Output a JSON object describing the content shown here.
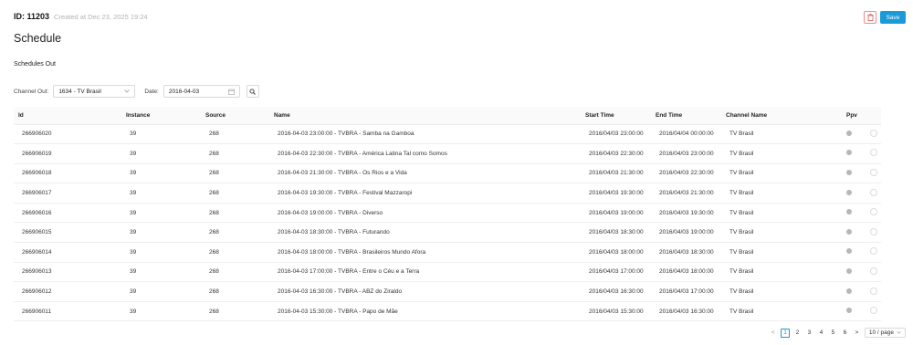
{
  "header": {
    "id_label": "ID: 11203",
    "created_text": "Created at Dec 23, 2025 19:24",
    "save_label": "Save"
  },
  "page_title": "Schedule",
  "section_title": "Schedules Out",
  "filters": {
    "channel_label": "Channel Out:",
    "channel_value": "1634 - TV Brasil",
    "date_label": "Date:",
    "date_value": "2016-04-03"
  },
  "table": {
    "columns": [
      "Id",
      "Instance",
      "Source",
      "Name",
      "Start Time",
      "End Time",
      "Channel Name",
      "Ppv"
    ],
    "rows": [
      {
        "id": "266906020",
        "instance": "39",
        "source": "268",
        "name": "2016-04-03 23:00:00 - TVBRA - Samba na Gamboa",
        "start": "2016/04/03 23:00:00",
        "end": "2016/04/04 00:00:00",
        "channel": "TV Brasil"
      },
      {
        "id": "266906019",
        "instance": "39",
        "source": "268",
        "name": "2016-04-03 22:30:00 - TVBRA - América Latina Tal como Somos",
        "start": "2016/04/03 22:30:00",
        "end": "2016/04/03 23:00:00",
        "channel": "TV Brasil"
      },
      {
        "id": "266906018",
        "instance": "39",
        "source": "268",
        "name": "2016-04-03 21:30:00 - TVBRA - Os Rios e a Vida",
        "start": "2016/04/03 21:30:00",
        "end": "2016/04/03 22:30:00",
        "channel": "TV Brasil"
      },
      {
        "id": "266906017",
        "instance": "39",
        "source": "268",
        "name": "2016-04-03 19:30:00 - TVBRA - Festival Mazzaropi",
        "start": "2016/04/03 19:30:00",
        "end": "2016/04/03 21:30:00",
        "channel": "TV Brasil"
      },
      {
        "id": "266906016",
        "instance": "39",
        "source": "268",
        "name": "2016-04-03 19:00:00 - TVBRA - Diverso",
        "start": "2016/04/03 19:00:00",
        "end": "2016/04/03 19:30:00",
        "channel": "TV Brasil"
      },
      {
        "id": "266906015",
        "instance": "39",
        "source": "268",
        "name": "2016-04-03 18:30:00 - TVBRA - Futurando",
        "start": "2016/04/03 18:30:00",
        "end": "2016/04/03 19:00:00",
        "channel": "TV Brasil"
      },
      {
        "id": "266906014",
        "instance": "39",
        "source": "268",
        "name": "2016-04-03 18:00:00 - TVBRA - Brasileiros Mundo Afora",
        "start": "2016/04/03 18:00:00",
        "end": "2016/04/03 18:30:00",
        "channel": "TV Brasil"
      },
      {
        "id": "266906013",
        "instance": "39",
        "source": "268",
        "name": "2016-04-03 17:00:00 - TVBRA - Entre o Céu e a Terra",
        "start": "2016/04/03 17:00:00",
        "end": "2016/04/03 18:00:00",
        "channel": "TV Brasil"
      },
      {
        "id": "266906012",
        "instance": "39",
        "source": "268",
        "name": "2016-04-03 16:30:00 - TVBRA - ABZ do Ziraldo",
        "start": "2016/04/03 16:30:00",
        "end": "2016/04/03 17:00:00",
        "channel": "TV Brasil"
      },
      {
        "id": "266906011",
        "instance": "39",
        "source": "268",
        "name": "2016-04-03 15:30:00 - TVBRA - Papo de Mãe",
        "start": "2016/04/03 15:30:00",
        "end": "2016/04/03 16:30:00",
        "channel": "TV Brasil"
      }
    ]
  },
  "pagination": {
    "pages": [
      "1",
      "2",
      "3",
      "4",
      "5",
      "6"
    ],
    "current": "1",
    "prev": "<",
    "next": ">",
    "page_size": "10 / page"
  },
  "icons": {
    "delete": "trash-icon",
    "select_arrow": "chevron-down-icon",
    "calendar": "calendar-icon",
    "search": "search-icon"
  },
  "colors": {
    "accent": "#1a9bd7",
    "danger": "#f08a8a"
  }
}
